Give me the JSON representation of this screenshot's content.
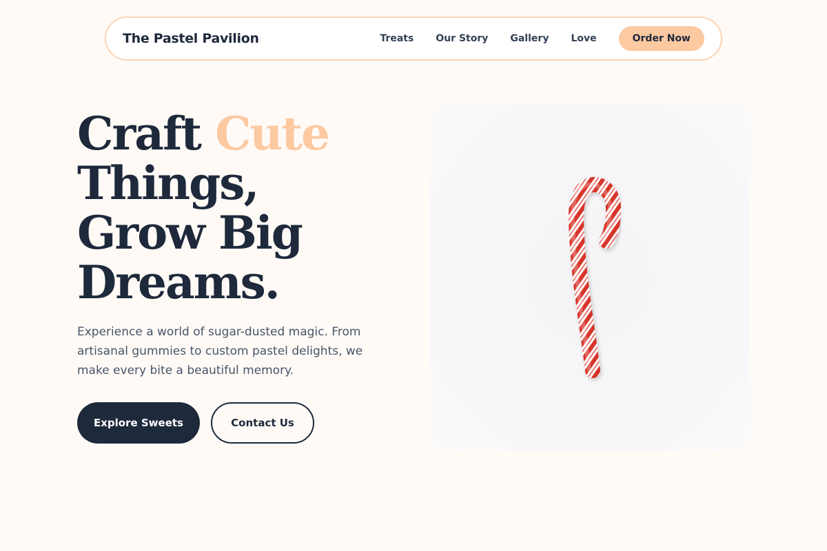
{
  "brand": {
    "name": "The Pastel Pavilion"
  },
  "nav": {
    "links": [
      "Treats",
      "Our Story",
      "Gallery",
      "Love"
    ],
    "cta": "Order Now"
  },
  "hero": {
    "title_word_1": "Craft",
    "title_accent": "Cute",
    "title_line_2": "Things,",
    "title_line_3": "Grow Big",
    "title_line_4": "Dreams.",
    "description": "Experience a world of sugar-dusted magic. From artisanal gummies to custom pastel delights, we make every bite a beautiful memory.",
    "primary_button": "Explore Sweets",
    "secondary_button": "Contact Us",
    "image_icon": "candy-cane-image"
  },
  "colors": {
    "background": "#fffaf6",
    "accent": "#fdc9a1",
    "navy": "#1e293b",
    "nav_border": "#fdd4b3"
  }
}
